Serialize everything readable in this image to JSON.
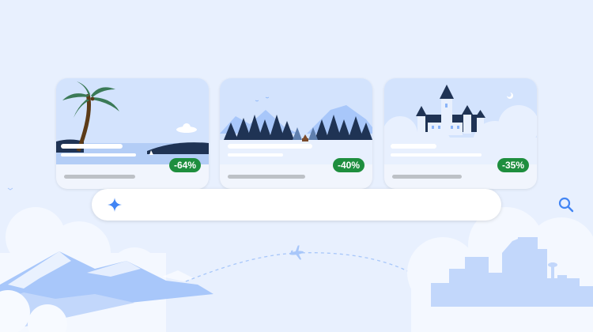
{
  "search": {
    "placeholder": "",
    "value": ""
  },
  "cards": [
    {
      "destination_type": "beach",
      "discount": "-64%"
    },
    {
      "destination_type": "forest",
      "discount": "-40%"
    },
    {
      "destination_type": "castle",
      "discount": "-35%"
    }
  ],
  "colors": {
    "background": "#e8f0fe",
    "discount_badge": "#1e8e3e",
    "search_accent": "#4285f4",
    "mountains": "#a8c7fa",
    "skyline": "#c2d7fb"
  },
  "icons": {
    "search_prefix": "sparkle-icon",
    "search_submit": "search-icon",
    "airplane": "airplane-icon"
  }
}
